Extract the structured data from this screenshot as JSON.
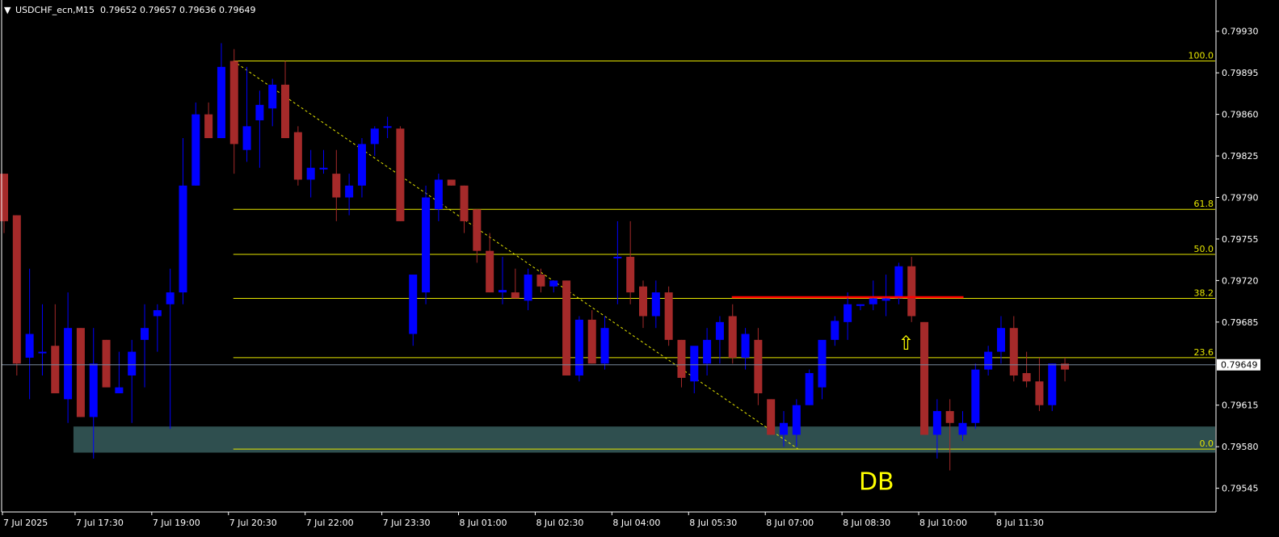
{
  "header": {
    "symbol_label": "USDCHF_ecn,M15",
    "ohlc_label": "0.79652 0.79657 0.79636 0.79649"
  },
  "colors": {
    "background": "#000000",
    "axis": "#ffffff",
    "bull_candle": "#0000ff",
    "bear_candle": "#a52a2a",
    "fib_line": "#e6e600",
    "resistance_line": "#ff0000",
    "zone_fill": "#2f4f4f",
    "bid_line": "#778899",
    "annotation": "#ffff00"
  },
  "chart_data": {
    "type": "candlestick",
    "symbol": "USDCHF_ecn",
    "timeframe": "M15",
    "ylim": [
      0.79525,
      0.79955
    ],
    "y_ticks": [
      "0.79930",
      "0.79895",
      "0.79860",
      "0.79825",
      "0.79790",
      "0.79755",
      "0.79720",
      "0.79685",
      "0.79649",
      "0.79615",
      "0.79580",
      "0.79545"
    ],
    "x_ticks": [
      "7 Jul 2025",
      "7 Jul 17:30",
      "7 Jul 19:00",
      "7 Jul 20:30",
      "7 Jul 22:00",
      "7 Jul 23:30",
      "8 Jul 01:00",
      "8 Jul 02:30",
      "8 Jul 04:00",
      "8 Jul 05:30",
      "8 Jul 07:00",
      "8 Jul 08:30",
      "8 Jul 10:00",
      "8 Jul 11:30"
    ],
    "current_price": "0.79649",
    "candles": [
      [
        0.7981,
        0.7981,
        0.7976,
        0.7977
      ],
      [
        0.79775,
        0.79775,
        0.7964,
        0.7965
      ],
      [
        0.79655,
        0.7973,
        0.7962,
        0.79675
      ],
      [
        0.7966,
        0.797,
        0.7964,
        0.7966
      ],
      [
        0.79665,
        0.797,
        0.7963,
        0.79625
      ],
      [
        0.7962,
        0.7971,
        0.796,
        0.7968
      ],
      [
        0.7968,
        0.7968,
        0.79605,
        0.79605
      ],
      [
        0.79605,
        0.7968,
        0.7957,
        0.7965
      ],
      [
        0.7967,
        0.7967,
        0.79635,
        0.7963
      ],
      [
        0.79625,
        0.7966,
        0.79625,
        0.7963
      ],
      [
        0.7964,
        0.7967,
        0.796,
        0.7966
      ],
      [
        0.7967,
        0.797,
        0.7963,
        0.7968
      ],
      [
        0.7969,
        0.797,
        0.7966,
        0.79695
      ],
      [
        0.797,
        0.7973,
        0.79595,
        0.7971
      ],
      [
        0.7971,
        0.7984,
        0.797,
        0.798
      ],
      [
        0.798,
        0.7987,
        0.798,
        0.7986
      ],
      [
        0.7986,
        0.7987,
        0.7984,
        0.7984
      ],
      [
        0.7984,
        0.7992,
        0.7984,
        0.799
      ],
      [
        0.79905,
        0.79915,
        0.7981,
        0.79835
      ],
      [
        0.7983,
        0.799,
        0.7982,
        0.7985
      ],
      [
        0.79855,
        0.7988,
        0.79815,
        0.79868
      ],
      [
        0.79865,
        0.7989,
        0.7985,
        0.79885
      ],
      [
        0.79885,
        0.79905,
        0.7984,
        0.7984
      ],
      [
        0.79845,
        0.7985,
        0.798,
        0.79805
      ],
      [
        0.79805,
        0.7983,
        0.7979,
        0.79815
      ],
      [
        0.79815,
        0.7983,
        0.7981,
        0.79815
      ],
      [
        0.7981,
        0.7983,
        0.7977,
        0.7979
      ],
      [
        0.7979,
        0.7981,
        0.79775,
        0.798
      ],
      [
        0.798,
        0.7984,
        0.7979,
        0.79835
      ],
      [
        0.79835,
        0.7985,
        0.79825,
        0.79848
      ],
      [
        0.7985,
        0.79858,
        0.7984,
        0.7985
      ],
      [
        0.79848,
        0.7985,
        0.7977,
        0.7977
      ],
      [
        0.79675,
        0.7972,
        0.79665,
        0.79725
      ],
      [
        0.7971,
        0.798,
        0.797,
        0.7979
      ],
      [
        0.7978,
        0.7981,
        0.7977,
        0.79805
      ],
      [
        0.79805,
        0.79805,
        0.798,
        0.798
      ],
      [
        0.798,
        0.798,
        0.7976,
        0.7977
      ],
      [
        0.7978,
        0.7978,
        0.79735,
        0.79745
      ],
      [
        0.79745,
        0.7976,
        0.7971,
        0.7971
      ],
      [
        0.7971,
        0.7974,
        0.797,
        0.79712
      ],
      [
        0.7971,
        0.7973,
        0.79705,
        0.79705
      ],
      [
        0.79703,
        0.7973,
        0.79695,
        0.79725
      ],
      [
        0.79725,
        0.7973,
        0.7971,
        0.79715
      ],
      [
        0.79715,
        0.7972,
        0.7971,
        0.7972
      ],
      [
        0.7972,
        0.7972,
        0.7964,
        0.7964
      ],
      [
        0.7964,
        0.7969,
        0.79635,
        0.79687
      ],
      [
        0.79687,
        0.79695,
        0.7965,
        0.7965
      ],
      [
        0.7965,
        0.7969,
        0.79645,
        0.7968
      ],
      [
        0.7974,
        0.7977,
        0.797,
        0.7974
      ],
      [
        0.7974,
        0.7977,
        0.797,
        0.7971
      ],
      [
        0.79715,
        0.7972,
        0.7968,
        0.7969
      ],
      [
        0.7969,
        0.7972,
        0.7968,
        0.7971
      ],
      [
        0.7971,
        0.79715,
        0.79665,
        0.7967
      ],
      [
        0.7967,
        0.7967,
        0.7963,
        0.79638
      ],
      [
        0.79635,
        0.7966,
        0.79625,
        0.79665
      ],
      [
        0.7965,
        0.7968,
        0.7964,
        0.7967
      ],
      [
        0.7967,
        0.7969,
        0.7965,
        0.79685
      ],
      [
        0.7969,
        0.797,
        0.7965,
        0.79655
      ],
      [
        0.79655,
        0.7968,
        0.79645,
        0.79675
      ],
      [
        0.7967,
        0.7968,
        0.79615,
        0.79625
      ],
      [
        0.7962,
        0.7962,
        0.7959,
        0.7959
      ],
      [
        0.7959,
        0.7961,
        0.7958,
        0.796
      ],
      [
        0.7959,
        0.7962,
        0.7958,
        0.79615
      ],
      [
        0.79615,
        0.79645,
        0.79615,
        0.79642
      ],
      [
        0.7963,
        0.7966,
        0.7962,
        0.7967
      ],
      [
        0.7967,
        0.7969,
        0.79665,
        0.79686
      ],
      [
        0.79685,
        0.7971,
        0.7967,
        0.797
      ],
      [
        0.797,
        0.797,
        0.79695,
        0.797
      ],
      [
        0.797,
        0.7972,
        0.79695,
        0.79705
      ],
      [
        0.79703,
        0.79725,
        0.7969,
        0.79705
      ],
      [
        0.79705,
        0.79735,
        0.797,
        0.79732
      ],
      [
        0.79732,
        0.7974,
        0.79685,
        0.7969
      ],
      [
        0.79685,
        0.79685,
        0.7959,
        0.7959
      ],
      [
        0.7959,
        0.7962,
        0.7957,
        0.7961
      ],
      [
        0.7961,
        0.7962,
        0.7956,
        0.796
      ],
      [
        0.7959,
        0.7961,
        0.79585,
        0.796
      ],
      [
        0.796,
        0.7965,
        0.79595,
        0.79645
      ],
      [
        0.79645,
        0.79665,
        0.7964,
        0.7966
      ],
      [
        0.7966,
        0.7969,
        0.7965,
        0.7968
      ],
      [
        0.7968,
        0.7969,
        0.79635,
        0.7964
      ],
      [
        0.79642,
        0.7966,
        0.7963,
        0.79635
      ],
      [
        0.79635,
        0.79655,
        0.7961,
        0.79615
      ],
      [
        0.79615,
        0.7965,
        0.7961,
        0.7965
      ],
      [
        0.7965,
        0.79655,
        0.79635,
        0.79645
      ]
    ],
    "candle_span": {
      "first_index": 0,
      "last_index": 83
    },
    "fibonacci": {
      "high": 0.79905,
      "low": 0.79578,
      "levels": [
        {
          "label": "100.0",
          "price": 0.79905
        },
        {
          "label": "61.8",
          "price": 0.7978
        },
        {
          "label": "50.0",
          "price": 0.79742
        },
        {
          "label": "38.2",
          "price": 0.79705
        },
        {
          "label": "23.6",
          "price": 0.79655
        },
        {
          "label": "0.0",
          "price": 0.79578
        }
      ]
    },
    "trendline": {
      "from_price": 0.79905,
      "to_price": 0.79578
    },
    "resistance_line": {
      "price": 0.79706
    },
    "zone": {
      "top_price": 0.79597,
      "bottom_price": 0.79575
    },
    "annotations": [
      {
        "text": "DB"
      },
      {
        "text": "⇧"
      }
    ]
  }
}
